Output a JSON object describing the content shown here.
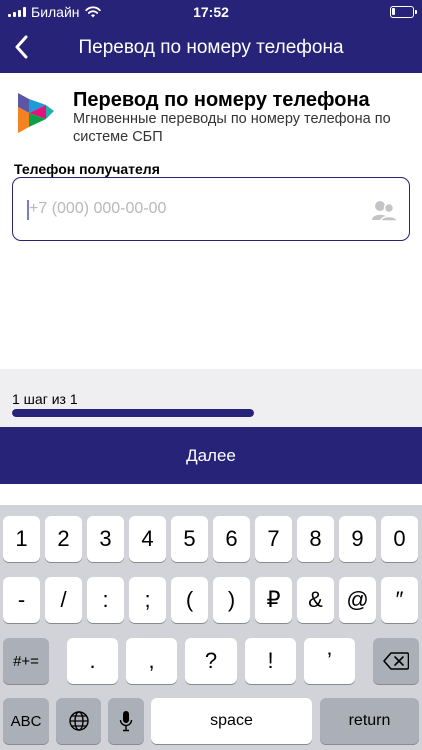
{
  "status_bar": {
    "carrier": "Билайн",
    "time": "17:52"
  },
  "nav": {
    "title": "Перевод по номеру телефона"
  },
  "header": {
    "title": "Перевод по номеру телефона",
    "subtitle": "Мгновенные переводы по номеру телефона по системе СБП"
  },
  "recipient": {
    "label": "Телефон получателя",
    "placeholder": "+7 (000) 000-00-00"
  },
  "step": {
    "text": "1 шаг из 1",
    "progress": 1.0
  },
  "next_button": {
    "label": "Далее"
  },
  "keyboard": {
    "row1": [
      "1",
      "2",
      "3",
      "4",
      "5",
      "6",
      "7",
      "8",
      "9",
      "0"
    ],
    "row2": [
      "-",
      "/",
      ":",
      ";",
      "(",
      ")",
      "₽",
      "&",
      "@",
      "″"
    ],
    "row3": [
      "#+=",
      ".",
      ",",
      "?",
      "!",
      "’"
    ],
    "row4": [
      "ABC",
      "space",
      "return"
    ]
  },
  "colors": {
    "brand": "#262378",
    "keyboard_bg": "#d1d3d9"
  }
}
